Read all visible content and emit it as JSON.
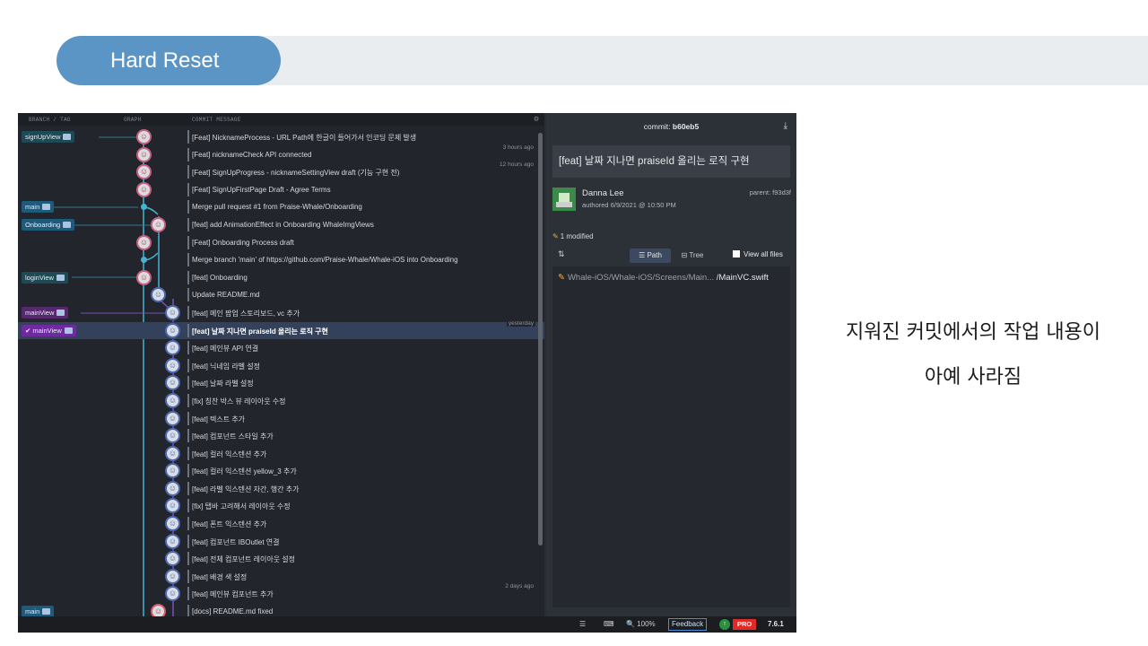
{
  "slide": {
    "title": "Hard Reset",
    "caption_line1": "지워진 커밋에서의 작업 내용이",
    "caption_line2": "아예 사라짐"
  },
  "columns": {
    "branch_tag": "BRANCH / TAG",
    "graph": "GRAPH",
    "commit_message": "COMMIT MESSAGE"
  },
  "commits": [
    {
      "message": "[Feat] NicknameProcess - URL Path에 한글이 들어가서 인코딩 문제 발생",
      "label": "signUpView",
      "label_style": "teal",
      "time": ""
    },
    {
      "message": "[Feat] nicknameCheck API connected",
      "label": "",
      "time": "3 hours ago"
    },
    {
      "message": "[Feat] SignUpProgress - nicknameSettingView draft (기능 구현 전)",
      "label": "",
      "time": "12 hours ago"
    },
    {
      "message": "[Feat] SignUpFirstPage Draft - Agree Terms",
      "label": "",
      "time": ""
    },
    {
      "message": "Merge pull request #1 from Praise-Whale/Onboarding",
      "label": "main",
      "label_style": "blue",
      "time": ""
    },
    {
      "message": "[feat] add AnimationEffect in Onboarding WhaleImgViews",
      "label": "Onboarding",
      "label_style": "blue",
      "time": ""
    },
    {
      "message": "[Feat] Onboarding Process draft",
      "label": "",
      "time": ""
    },
    {
      "message": "Merge branch 'main' of https://github.com/Praise-Whale/Whale-iOS into Onboarding",
      "label": "",
      "time": ""
    },
    {
      "message": "[feat] Onboarding",
      "label": "loginView",
      "label_style": "teal",
      "time": ""
    },
    {
      "message": "Update README.md",
      "label": "",
      "time": ""
    },
    {
      "message": "[feat] 메인 팝업 스토리보드, vc 추가",
      "label": "mainView",
      "label_style": "purple",
      "time": ""
    },
    {
      "message": "[feat] 날짜 지나면 praiseId 올리는 로직 구현",
      "label": "✔ mainView",
      "label_style": "purple-strong",
      "time": "yesterday",
      "selected": true
    },
    {
      "message": "[feat] 메인뷰 API 연결",
      "label": "",
      "time": ""
    },
    {
      "message": "[feat] 닉네임 라벨 설정",
      "label": "",
      "time": ""
    },
    {
      "message": "[feat] 날짜 라벨 설정",
      "label": "",
      "time": ""
    },
    {
      "message": "[fix] 칭찬 박스 뷰 레이아웃 수정",
      "label": "",
      "time": ""
    },
    {
      "message": "[feat] 텍스트 추가",
      "label": "",
      "time": ""
    },
    {
      "message": "[feat] 컴포넌트 스타일 추가",
      "label": "",
      "time": ""
    },
    {
      "message": "[feat] 컬러 익스텐션 추가",
      "label": "",
      "time": ""
    },
    {
      "message": "[feat] 컬러 익스텐션 yellow_3 추가",
      "label": "",
      "time": ""
    },
    {
      "message": "[feat] 라벨 익스텐션 자간, 행간 추가",
      "label": "",
      "time": ""
    },
    {
      "message": "[fix] 탭바 고려해서 레이아웃 수정",
      "label": "",
      "time": ""
    },
    {
      "message": "[feat] 폰트 익스텐션 추가",
      "label": "",
      "time": ""
    },
    {
      "message": "[feat] 컴포넌트 IBOutlet 연결",
      "label": "",
      "time": ""
    },
    {
      "message": "[feat] 전체 컴포넌트 레이아웃 설정",
      "label": "",
      "time": ""
    },
    {
      "message": "[feat] 배경 색 설정",
      "label": "",
      "time": ""
    },
    {
      "message": "[feat] 메인뷰 컴포넌트 추가",
      "label": "",
      "time": "2 days ago"
    },
    {
      "message": "[docs] README.md fixed",
      "label": "main",
      "label_style": "blue",
      "time": ""
    }
  ],
  "details": {
    "commit_label": "commit:",
    "commit_sha": "b60eb5",
    "summary": "[feat] 날짜 지나면 praiseId 올리는 로직 구현",
    "author": "Danna Lee",
    "authored": "authored 6/9/2021 @ 10:50 PM",
    "parent": "parent: f93d3f",
    "modified": "1 modified",
    "path_button": "☰ Path",
    "tree_button": "⊟ Tree",
    "view_all": "View all files",
    "file_dir": "Whale-iOS/Whale-iOS/Screens/Main...",
    "file_name": "/MainVC.swift"
  },
  "statusbar": {
    "zoom": "🔍 100%",
    "feedback": "Feedback",
    "pro": "PRO",
    "version": "7.6.1"
  },
  "colors": {
    "accent_blue": "#5b95c5",
    "branch_cyan": "#45b2cf",
    "branch_purple": "#7a52b3",
    "selected_row": "#33415a"
  }
}
